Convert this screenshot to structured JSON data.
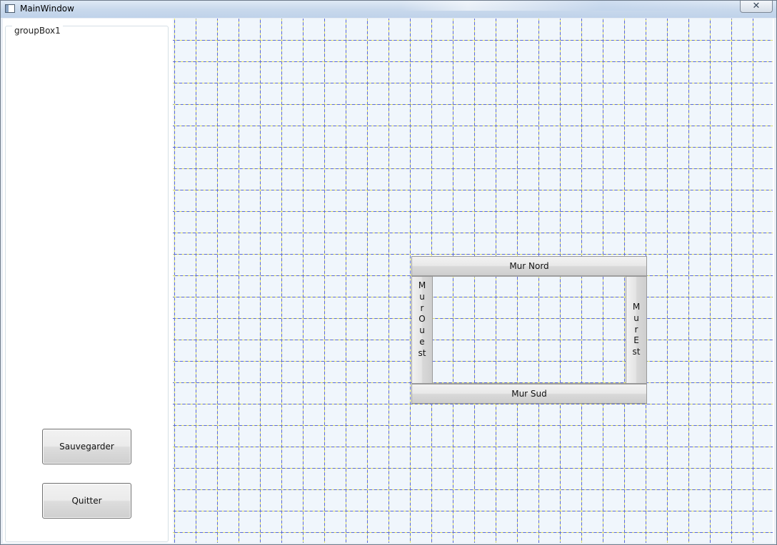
{
  "window": {
    "title": "MainWindow",
    "close_glyph": "✕"
  },
  "sidebar": {
    "groupbox_title": "groupBox1",
    "save_label": "Sauvegarder",
    "quit_label": "Quitter"
  },
  "room": {
    "north_wall": "Mur Nord",
    "south_wall": "Mur Sud",
    "west_wall": "Mur Ouest",
    "east_wall": "Mur Est"
  },
  "icons": {
    "app": "app-window-icon",
    "close": "close-icon"
  },
  "colors": {
    "grid_line_blue": "#5a68d8",
    "grid_line_yellow": "#f0f05a",
    "canvas_bg": "#f0f6fc",
    "titlebar": "#c9d9ec"
  }
}
